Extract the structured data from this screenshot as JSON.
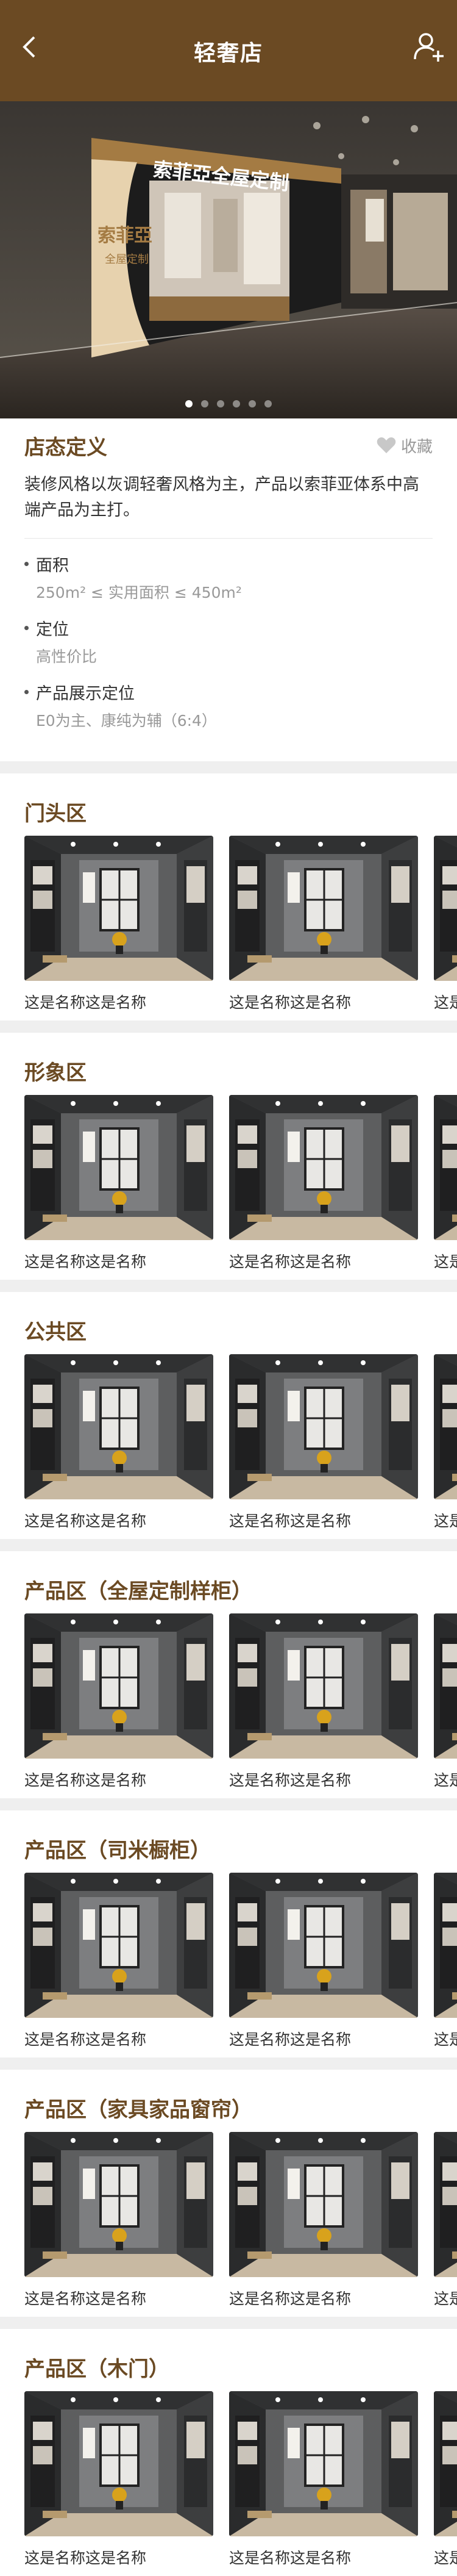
{
  "header": {
    "title": "轻奢店"
  },
  "hero": {
    "slides": 6,
    "active": 1,
    "sign_main": "索菲亞全屋定制",
    "sign_logo": "索菲亞",
    "sign_sub": "全屋定制"
  },
  "info": {
    "title": "店态定义",
    "favorite_label": "收藏",
    "description": "装修风格以灰调轻奢风格为主，产品以索菲亚体系中高端产品为主打。",
    "attrs": [
      {
        "label": "面积",
        "value": "250m² ≤ 实用面积 ≤ 450m²"
      },
      {
        "label": "定位",
        "value": "高性价比"
      },
      {
        "label": "产品展示定位",
        "value": "E0为主、康纯为辅（6:4）"
      }
    ]
  },
  "sections": [
    {
      "title": "门头区",
      "items": [
        "这是名称这是名称",
        "这是名称这是名称",
        "这是名称这是名称"
      ]
    },
    {
      "title": "形象区",
      "items": [
        "这是名称这是名称",
        "这是名称这是名称",
        "这是名称这是名称"
      ]
    },
    {
      "title": "公共区",
      "items": [
        "这是名称这是名称",
        "这是名称这是名称",
        "这是名称这是名称"
      ]
    },
    {
      "title": "产品区（全屋定制样柜）",
      "items": [
        "这是名称这是名称",
        "这是名称这是名称",
        "这是名称这是名称"
      ]
    },
    {
      "title": "产品区（司米橱柜）",
      "items": [
        "这是名称这是名称",
        "这是名称这是名称",
        "这是名称这是名称"
      ]
    },
    {
      "title": "产品区（家具家品窗帘）",
      "items": [
        "这是名称这是名称",
        "这是名称这是名称",
        "这是名称这是名称"
      ]
    },
    {
      "title": "产品区（木门）",
      "items": [
        "这是名称这是名称",
        "这是名称这是名称",
        "这是名称这是名称"
      ]
    }
  ]
}
